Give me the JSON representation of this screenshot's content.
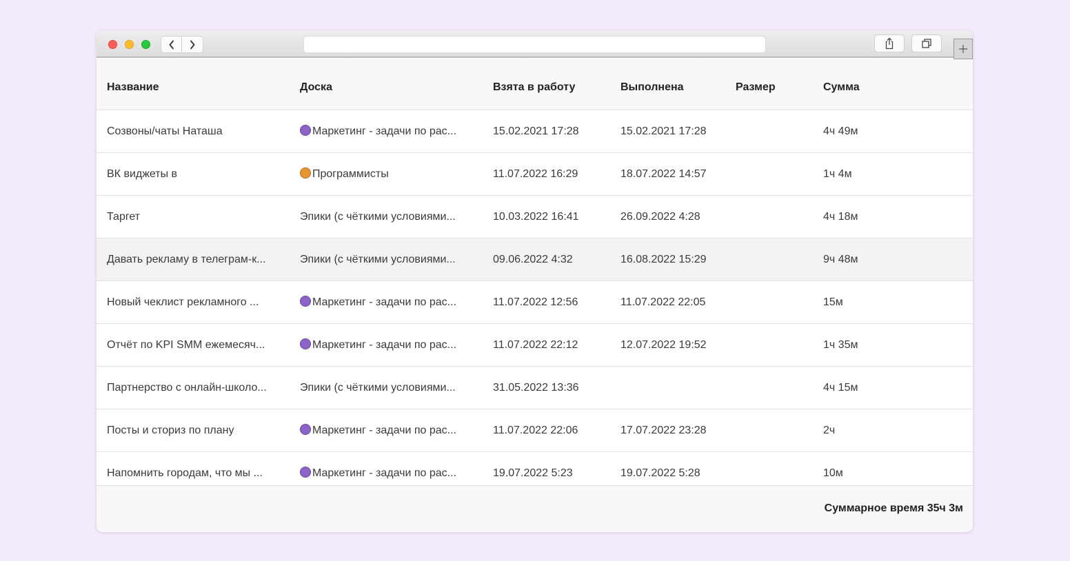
{
  "window": {
    "address_value": ""
  },
  "icons": {
    "back": "chevron-left-icon",
    "forward": "chevron-right-icon",
    "share": "share-icon",
    "tabs": "tabs-overview-icon",
    "new_tab": "plus-icon"
  },
  "colors": {
    "background": "#f3ebfb",
    "marketing_board_icon": "#8c63c9",
    "programmers_board_icon": "#e8952e"
  },
  "table": {
    "headers": {
      "name": "Название",
      "board": "Доска",
      "taken": "Взята в работу",
      "done": "Выполнена",
      "size": "Размер",
      "sum": "Сумма"
    },
    "rows": [
      {
        "name": "Созвоны/чаты Наташа",
        "board": "Маркетинг - задачи по рас...",
        "board_icon": "marketing",
        "taken": "15.02.2021 17:28",
        "done": "15.02.2021 17:28",
        "size": "",
        "sum": "4ч 49м"
      },
      {
        "name": "ВК виджеты в",
        "board": "Программисты",
        "board_icon": "programmers",
        "taken": "11.07.2022 16:29",
        "done": "18.07.2022 14:57",
        "size": "",
        "sum": "1ч 4м"
      },
      {
        "name": "Таргет",
        "board": "Эпики (с чёткими условиями...",
        "board_icon": "",
        "taken": "10.03.2022 16:41",
        "done": "26.09.2022 4:28",
        "size": "",
        "sum": "4ч 18м"
      },
      {
        "name": "Давать рекламу в телеграм-к...",
        "board": "Эпики (с чёткими условиями...",
        "board_icon": "",
        "taken": "09.06.2022 4:32",
        "done": "16.08.2022 15:29",
        "size": "",
        "sum": "9ч 48м"
      },
      {
        "name": "Новый чеклист рекламного ...",
        "board": "Маркетинг - задачи по рас...",
        "board_icon": "marketing",
        "taken": "11.07.2022 12:56",
        "done": "11.07.2022 22:05",
        "size": "",
        "sum": "15м"
      },
      {
        "name": "Отчёт по KPI SMM ежемесяч...",
        "board": "Маркетинг - задачи по рас...",
        "board_icon": "marketing",
        "taken": "11.07.2022 22:12",
        "done": "12.07.2022 19:52",
        "size": "",
        "sum": "1ч 35м"
      },
      {
        "name": "Партнерство с онлайн-школо...",
        "board": "Эпики (с чёткими условиями...",
        "board_icon": "",
        "taken": "31.05.2022 13:36",
        "done": "",
        "size": "",
        "sum": "4ч 15м"
      },
      {
        "name": "Посты и сториз по плану",
        "board": "Маркетинг - задачи по рас...",
        "board_icon": "marketing",
        "taken": "11.07.2022 22:06",
        "done": "17.07.2022 23:28",
        "size": "",
        "sum": "2ч"
      },
      {
        "name": "Напомнить городам, что мы ...",
        "board": "Маркетинг - задачи по рас...",
        "board_icon": "marketing",
        "taken": "19.07.2022 5:23",
        "done": "19.07.2022 5:28",
        "size": "",
        "sum": "10м"
      }
    ],
    "highlighted_row": 3
  },
  "footer": {
    "total_label": "Суммарное время 35ч 3м"
  }
}
